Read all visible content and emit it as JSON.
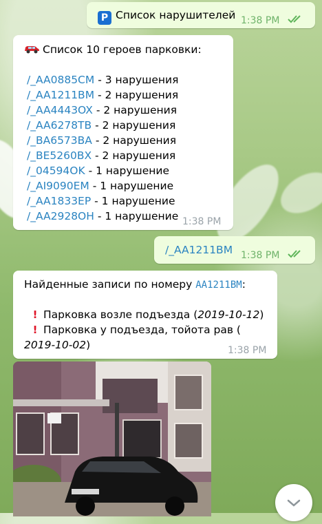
{
  "msg1": {
    "text": "Список нарушителей",
    "time": "1:38 PM",
    "icon": "parking-p-icon"
  },
  "msg2": {
    "header": "Список 10 героев парковки:",
    "icon": "red-car-icon",
    "items": [
      {
        "plate": "/_AA0885CM",
        "count": " - 3 нарушения"
      },
      {
        "plate": "/_AA1211BM",
        "count": " - 2 нарушения"
      },
      {
        "plate": "/_AA4443OX",
        "count": " - 2 нарушения"
      },
      {
        "plate": "/_AA6278TB",
        "count": " - 2 нарушения"
      },
      {
        "plate": "/_BA6573BA",
        "count": " - 2 нарушения"
      },
      {
        "plate": "/_BE5260BX",
        "count": " - 2 нарушения"
      },
      {
        "plate": "/_04594OK",
        "count": " - 1 нарушение"
      },
      {
        "plate": "/_AI9090EM",
        "count": " - 1 нарушение"
      },
      {
        "plate": "/_AA1833EP",
        "count": " - 1 нарушение"
      },
      {
        "plate": "/_AA2928OH",
        "count": " - 1 нарушение"
      }
    ],
    "time": "1:38 PM"
  },
  "msg3": {
    "text": "/_AA1211BM",
    "time": "1:38 PM"
  },
  "msg4": {
    "prefix": "Найденные записи по номеру ",
    "plate": "AA1211BM",
    "suffix": ":",
    "r1_text": "Парковка возле подъезда (",
    "r1_date": "2019-10-12",
    "r1_close": ")",
    "r2_text": "Парковка у подъезда, тойота рав (",
    "r2_date": "2019-10-02",
    "r2_close": ")",
    "time": "1:38 PM"
  },
  "scroll_icon": "chevron-down-icon",
  "colors": {
    "link": "#2b84c1",
    "outgoing": "#effdde",
    "check": "#5fb55a",
    "alert": "#e0172a"
  }
}
